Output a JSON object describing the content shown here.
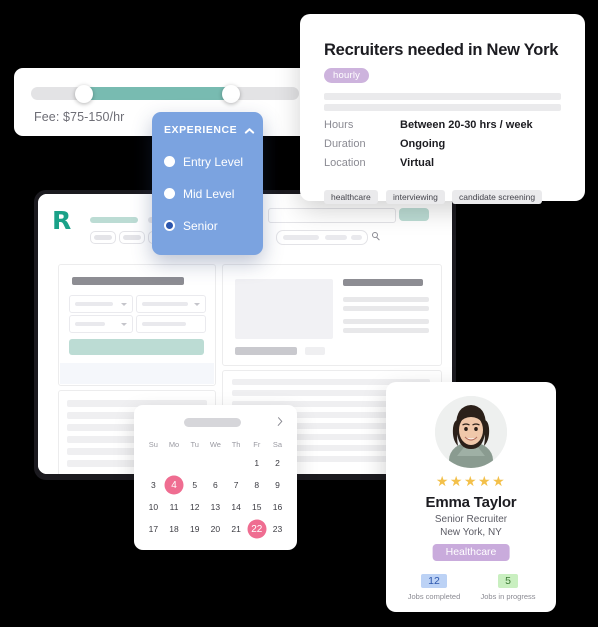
{
  "fee_filter": {
    "label": "Fee: $75-150/hr",
    "range_min_handle_pct": 13,
    "range_max_handle_pct": 68,
    "track_color": "#e3e3e5",
    "fill_color": "#78bbb1"
  },
  "experience_filter": {
    "title": "EXPERIENCE",
    "collapse_icon": "chevron-up-icon",
    "accent_color": "#7ba3e0",
    "options": [
      {
        "label": "Entry Level",
        "selected": false
      },
      {
        "label": "Mid Level",
        "selected": false
      },
      {
        "label": "Senior",
        "selected": true
      }
    ]
  },
  "job_card": {
    "title": "Recruiters needed in New York",
    "type_pill": "hourly",
    "type_pill_color": "#cdb3dd",
    "details": [
      {
        "key": "Hours",
        "value": "Between 20-30 hrs / week"
      },
      {
        "key": "Duration",
        "value": "Ongoing"
      },
      {
        "key": "Location",
        "value": "Virtual"
      }
    ],
    "tags": [
      "healthcare",
      "interviewing",
      "candidate screening"
    ]
  },
  "dashboard": {
    "logo": "R",
    "logo_color": "#1aa188",
    "search_icon": "search-icon",
    "accent_color": "#bcdcd4"
  },
  "calendar": {
    "next_icon": "chevron-right-icon",
    "weekdays": [
      "Su",
      "Mo",
      "Tu",
      "We",
      "Th",
      "Fr",
      "Sa"
    ],
    "weeks": [
      [
        "",
        "",
        "",
        "",
        "",
        "1",
        "2"
      ],
      [
        "3",
        "4",
        "5",
        "6",
        "7",
        "8",
        "9"
      ],
      [
        "10",
        "11",
        "12",
        "13",
        "14",
        "15",
        "16"
      ],
      [
        "17",
        "18",
        "19",
        "20",
        "21",
        "22",
        "23"
      ]
    ],
    "selected_days": [
      "4",
      "22"
    ],
    "selected_color": "#ef6d91"
  },
  "profile_card": {
    "avatar": "profile-photo",
    "rating_stars": 5,
    "star_symbol": "★",
    "star_color": "#f3c04a",
    "name": "Emma Taylor",
    "role": "Senior Recruiter",
    "location": "New York, NY",
    "specialty_badge": "Healthcare",
    "specialty_color": "#c9abdc",
    "stats": [
      {
        "value": "12",
        "caption": "Jobs completed",
        "color": "#bcd2f5"
      },
      {
        "value": "5",
        "caption": "Jobs in progress",
        "color": "#c9efc0"
      }
    ]
  }
}
